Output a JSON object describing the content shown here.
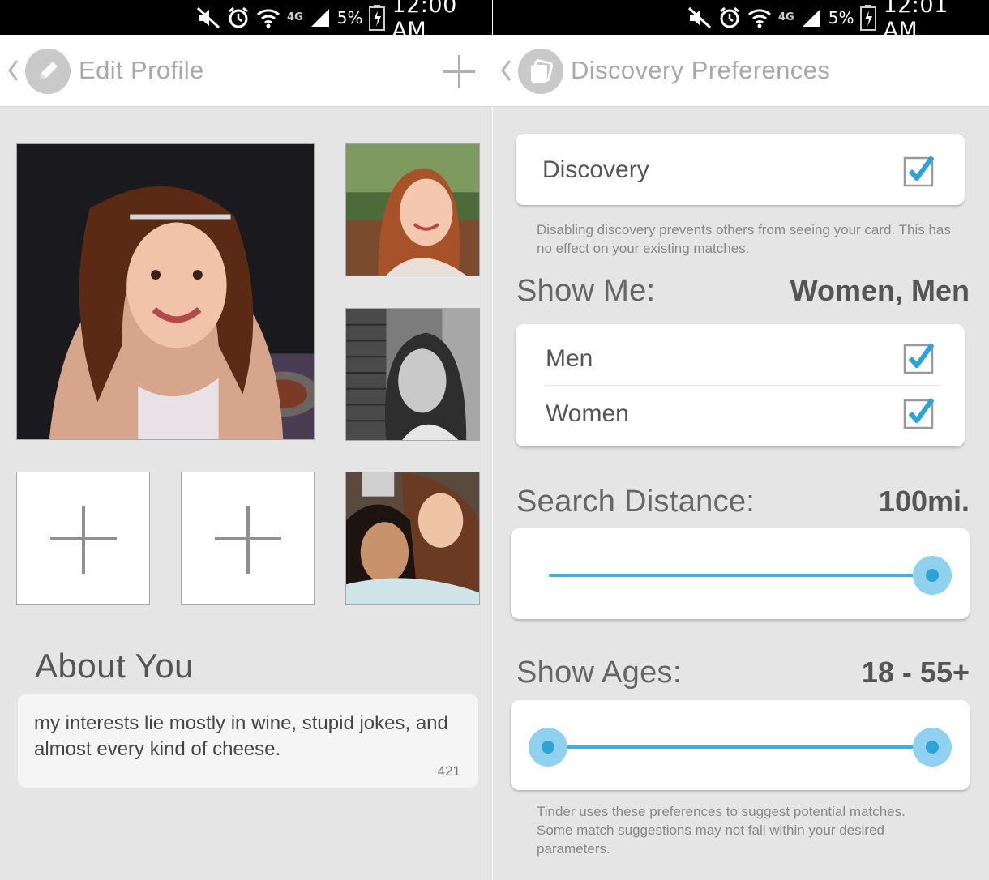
{
  "left_screen": {
    "status_bar": {
      "network": "4G",
      "battery_percent": "5%",
      "time": "12:00 AM"
    },
    "action_bar": {
      "title": "Edit Profile",
      "add_icon": "plus-icon",
      "logo_icon": "pencil-icon"
    },
    "photos": [
      {
        "slot": "main",
        "kind": "photo"
      },
      {
        "slot": "side-1",
        "kind": "photo"
      },
      {
        "slot": "side-2",
        "kind": "photo"
      },
      {
        "slot": "bottom-1",
        "kind": "empty"
      },
      {
        "slot": "bottom-2",
        "kind": "empty"
      },
      {
        "slot": "bottom-3",
        "kind": "photo"
      }
    ],
    "about": {
      "title": "About You",
      "text": "my interests lie mostly in wine, stupid jokes, and almost every kind of cheese.",
      "remaining_chars": "421"
    }
  },
  "right_screen": {
    "status_bar": {
      "network": "4G",
      "battery_percent": "5%",
      "time": "12:01 AM"
    },
    "action_bar": {
      "title": "Discovery Preferences",
      "logo_icon": "tinder-cards-icon"
    },
    "discovery": {
      "label": "Discovery",
      "checked": true,
      "note": "Disabling discovery prevents others from seeing your card. This has no effect on your existing matches."
    },
    "show_me": {
      "title": "Show Me:",
      "value": "Women, Men",
      "options": [
        {
          "label": "Men",
          "checked": true
        },
        {
          "label": "Women",
          "checked": true
        }
      ]
    },
    "search_distance": {
      "title": "Search Distance:",
      "value": "100mi.",
      "slider_fraction": 1.0
    },
    "show_ages": {
      "title": "Show Ages:",
      "value": "18 - 55+",
      "min_age": 18,
      "max_age": 55
    },
    "footer_note": "Tinder uses these preferences to suggest potential matches. Some match suggestions may not fall within your desired parameters."
  },
  "colors": {
    "accent": "#3db0e0",
    "accent_light": "#8fd1ee",
    "background": "#e5e5e5",
    "check_blue": "#2aa3d8"
  }
}
